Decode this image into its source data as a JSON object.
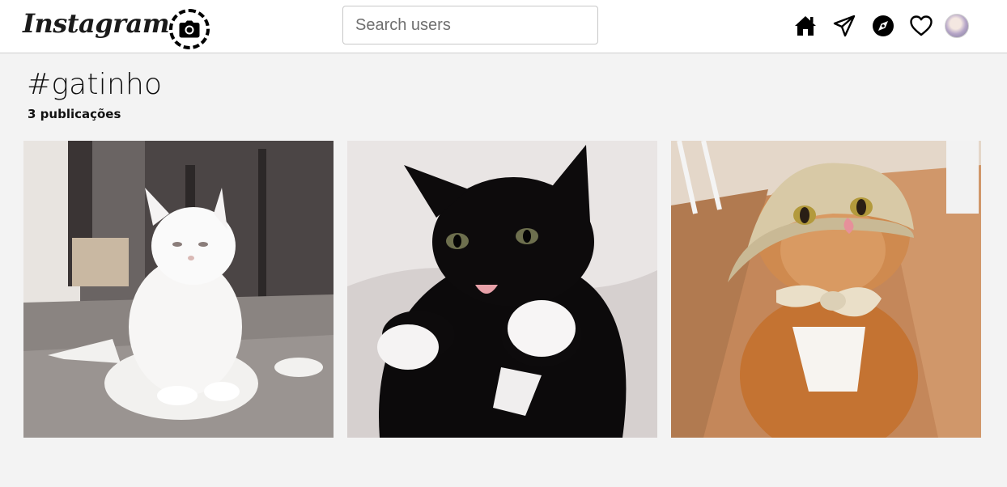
{
  "header": {
    "logo_text": "Instagram",
    "search": {
      "placeholder": "Search users",
      "value": ""
    },
    "icons": [
      "camera-icon",
      "home-icon",
      "paper-plane-icon",
      "compass-icon",
      "heart-icon"
    ]
  },
  "hashtag": {
    "title": "#gatinho",
    "post_count": "3 publicações"
  },
  "posts": [
    {
      "subject": "white cat sitting"
    },
    {
      "subject": "black and white cat with tongue out"
    },
    {
      "subject": "orange tabby cat wearing hat and bow"
    }
  ],
  "colors": {
    "topbar_bg": "#ffffff",
    "page_bg": "#f3f3f3",
    "text": "#111111",
    "border": "#cfcfcf"
  }
}
